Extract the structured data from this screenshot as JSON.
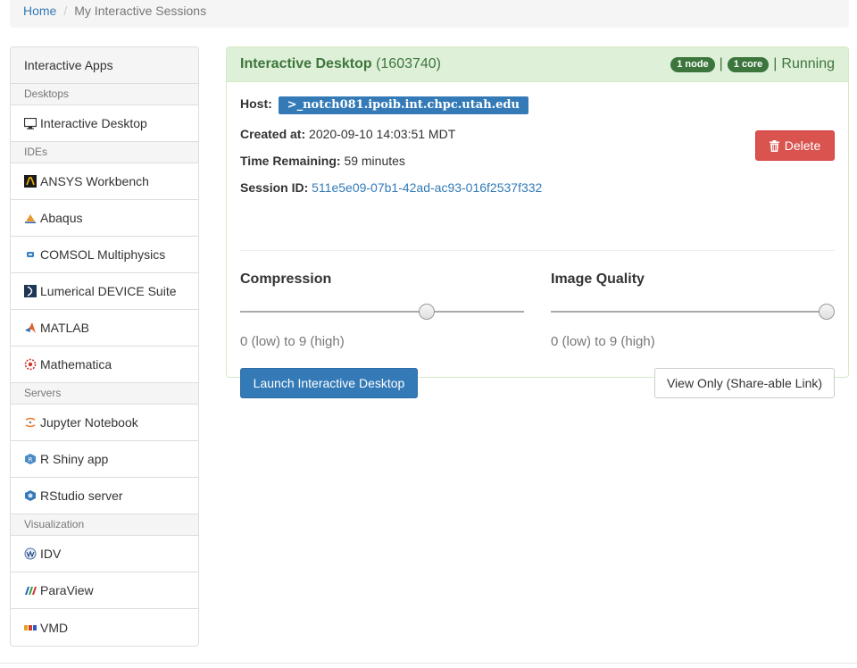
{
  "breadcrumb": {
    "home": "Home",
    "separator": "/",
    "current": "My Interactive Sessions"
  },
  "sidebar": {
    "heading": "Interactive Apps",
    "categories": [
      {
        "label": "Desktops",
        "items": [
          {
            "label": "Interactive Desktop",
            "icon": "monitor-icon"
          }
        ]
      },
      {
        "label": "IDEs",
        "items": [
          {
            "label": "ANSYS Workbench",
            "icon": "ansys-icon"
          },
          {
            "label": "Abaqus",
            "icon": "abaqus-icon"
          },
          {
            "label": "COMSOL Multiphysics",
            "icon": "comsol-icon"
          },
          {
            "label": "Lumerical DEVICE Suite",
            "icon": "lumerical-icon"
          },
          {
            "label": "MATLAB",
            "icon": "matlab-icon"
          },
          {
            "label": "Mathematica",
            "icon": "mathematica-icon"
          }
        ]
      },
      {
        "label": "Servers",
        "items": [
          {
            "label": "Jupyter Notebook",
            "icon": "jupyter-icon"
          },
          {
            "label": "R Shiny app",
            "icon": "rshiny-icon"
          },
          {
            "label": "RStudio server",
            "icon": "rstudio-icon"
          }
        ]
      },
      {
        "label": "Visualization",
        "items": [
          {
            "label": "IDV",
            "icon": "idv-icon"
          },
          {
            "label": "ParaView",
            "icon": "paraview-icon"
          },
          {
            "label": "VMD",
            "icon": "vmd-icon"
          }
        ]
      }
    ]
  },
  "session": {
    "title": "Interactive Desktop",
    "id_display": "(1603740)",
    "nodes_badge": "1 node",
    "cores_badge": "1 core",
    "separator": "|",
    "status": "Running",
    "host_label": "Host:",
    "host_prompt": ">_",
    "host_value": "notch081.ipoib.int.chpc.utah.edu",
    "created_label": "Created at:",
    "created_value": "2020-09-10 14:03:51 MDT",
    "time_label": "Time Remaining:",
    "time_value": "59 minutes",
    "session_label": "Session ID:",
    "session_value": "511e5e09-07b1-42ad-ac93-016f2537f332",
    "delete_label": "Delete",
    "compression": {
      "label": "Compression",
      "hint": "0 (low) to 9 (high)",
      "min": 0,
      "max": 9,
      "value": 6
    },
    "image_quality": {
      "label": "Image Quality",
      "hint": "0 (low) to 9 (high)",
      "min": 0,
      "max": 9,
      "value": 9
    },
    "launch_label": "Launch Interactive Desktop",
    "view_only_label": "View Only (Share-able Link)"
  },
  "colors": {
    "success_bg": "#dff0d8",
    "success_text": "#3c763d",
    "primary": "#337ab7",
    "danger": "#d9534f"
  }
}
